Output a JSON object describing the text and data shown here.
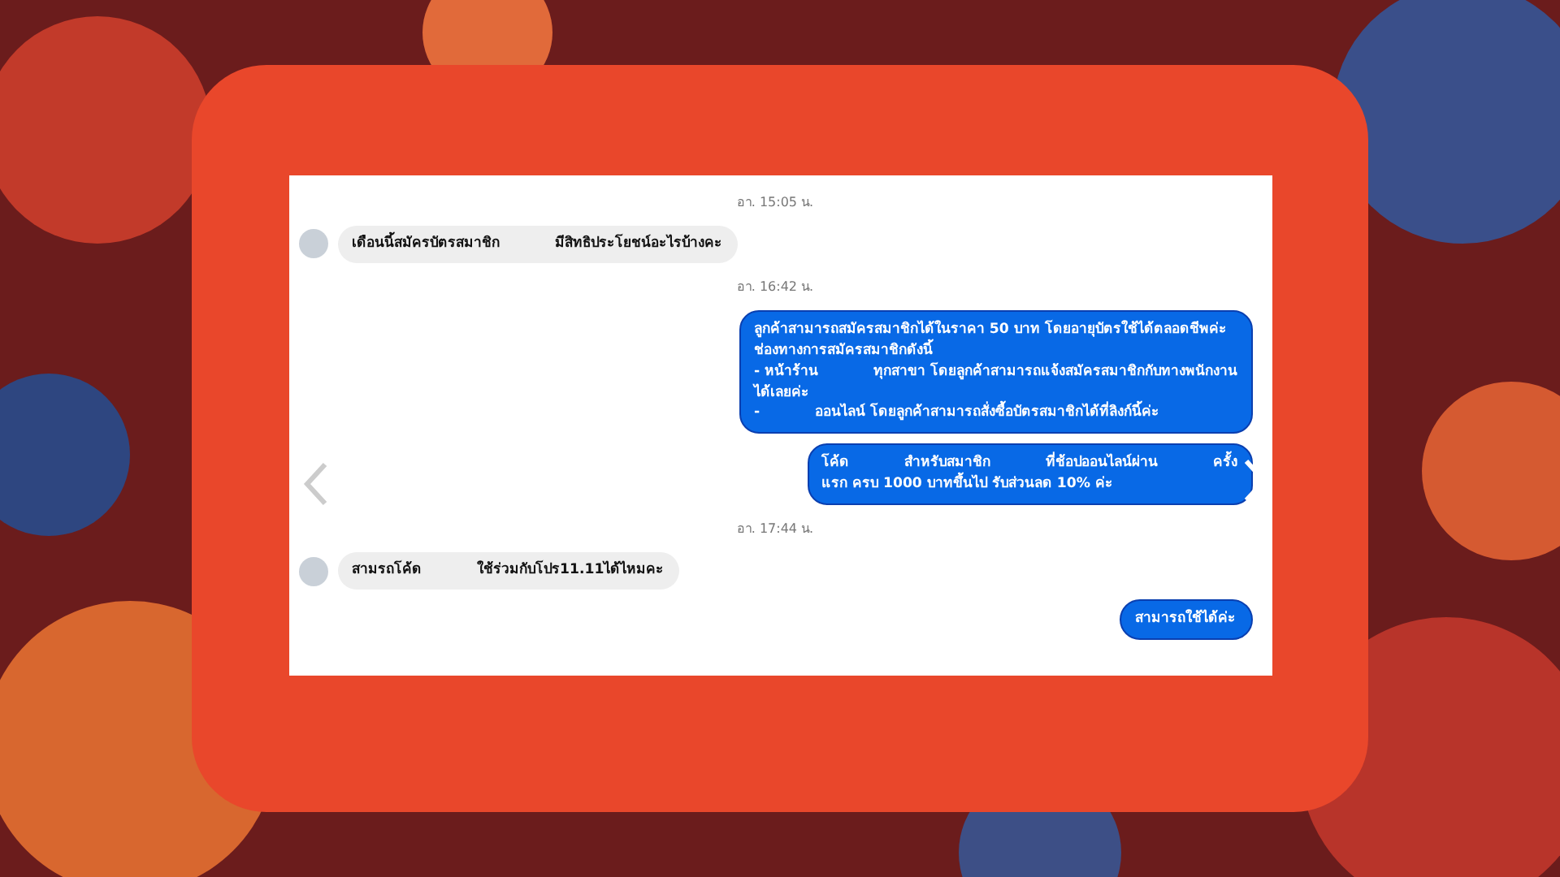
{
  "chat": {
    "messages": [
      {
        "kind": "time",
        "text": "อา. 15:05 น."
      },
      {
        "kind": "incoming",
        "lines": [
          [
            "เดือนนี้สมัครบัตรสมาชิก",
            "มีสิทธิประโยชน์อะไรบ้างคะ"
          ]
        ]
      },
      {
        "kind": "time",
        "text": "อา. 16:42 น."
      },
      {
        "kind": "outgoing",
        "lines": [
          [
            "ลูกค้าสามารถสมัครสมาชิกได้ในราคา 50 บาท โดยอายุบัตรใช้ได้ตลอดชีพค่ะ"
          ],
          [
            "ช่องทางการสมัครสมาชิกดังนี้"
          ],
          [
            "- หน้าร้าน",
            "ทุกสาขา โดยลูกค้าสามารถแจ้งสมัครสมาชิกกับทางพนักงาน"
          ],
          [
            "ได้เลยค่ะ"
          ],
          [
            "-",
            "ออนไลน์ โดยลูกค้าสามารถสั่งซื้อบัตรสมาชิกได้ที่ลิงก์นี้ค่ะ"
          ]
        ]
      },
      {
        "kind": "outgoing",
        "lines": [
          [
            "โค้ด",
            "สำหรับสมาชิก",
            "ที่ช้อปออนไลน์ผ่าน",
            "ครั้ง"
          ],
          [
            "แรก ครบ 1000 บาทขึ้นไป รับส่วนลด 10% ค่ะ"
          ]
        ]
      },
      {
        "kind": "time",
        "text": "อา. 17:44 น."
      },
      {
        "kind": "incoming",
        "lines": [
          [
            "สามรถโค้ด",
            "ใช้ร่วมกับโปร11.11ได้ไหมคะ"
          ]
        ]
      },
      {
        "kind": "outgoing",
        "lines": [
          [
            "สามารถใช้ได้ค่ะ"
          ]
        ]
      }
    ]
  }
}
